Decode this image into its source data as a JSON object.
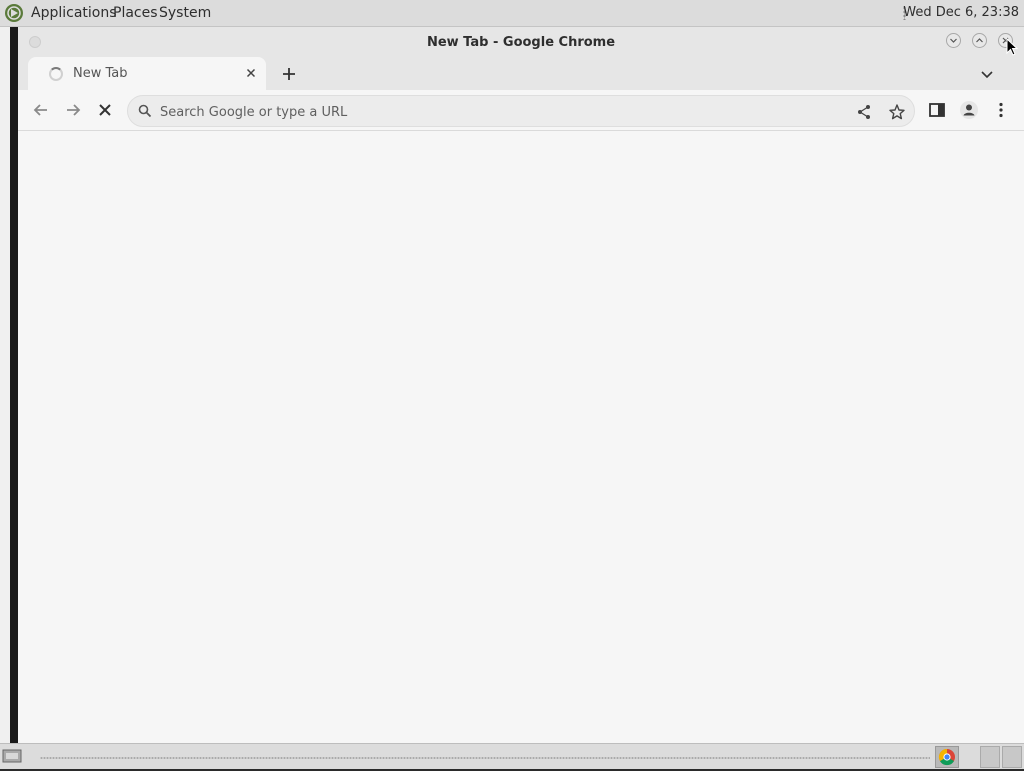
{
  "topbar": {
    "menus": [
      "Applications",
      "Places",
      "System"
    ],
    "clock": "Wed Dec 6, 23:38"
  },
  "window": {
    "title": "New Tab - Google Chrome"
  },
  "tabs": [
    {
      "label": "New Tab",
      "loading": true
    }
  ],
  "omnibox": {
    "placeholder": "Search Google or type a URL",
    "value": ""
  },
  "icons": {
    "back": "arrow-left-icon",
    "forward": "arrow-right-icon",
    "stop": "close-icon",
    "share": "share-icon",
    "bookmark": "star-icon",
    "side_panel": "side-panel-icon",
    "profile": "person-icon",
    "menu": "kebab-menu-icon"
  },
  "colors": {
    "content_bg": "#f6f6f6",
    "titlebar_bg": "#e6e6e6",
    "panel_bg": "#dcdcdc"
  }
}
